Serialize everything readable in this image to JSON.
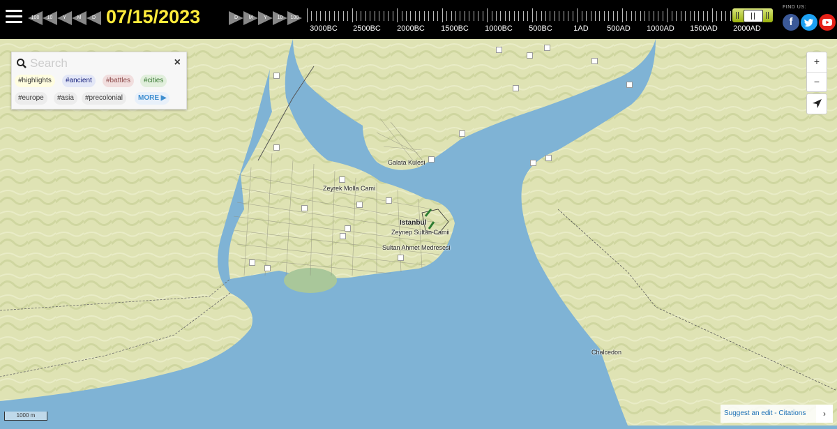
{
  "header": {
    "date": "07/15/2023",
    "back_buttons": [
      "100",
      "10",
      "Y",
      "M",
      "D"
    ],
    "forward_buttons": [
      "D",
      "M",
      "Y",
      "10",
      "100"
    ],
    "timeline_labels": [
      "3000BC",
      "2500BC",
      "2000BC",
      "1500BC",
      "1000BC",
      "500BC",
      "1AD",
      "500AD",
      "1000AD",
      "1500AD",
      "2000AD"
    ],
    "find_us": "FIND US:"
  },
  "social": {
    "facebook": "facebook-icon",
    "twitter": "twitter-icon",
    "youtube": "youtube-icon"
  },
  "search": {
    "placeholder": "Search",
    "close": "×",
    "tags": [
      "#highlights",
      "#ancient",
      "#battles",
      "#cities",
      "#europe",
      "#asia",
      "#precolonial"
    ],
    "more": "MORE ▶"
  },
  "controls": {
    "zoom_in": "+",
    "zoom_out": "−"
  },
  "map_labels": {
    "galata": "Galata Kulesi",
    "zeyrek": "Zeyrek Molla Cami",
    "istanbul": "Istanbul",
    "zeynep": "Zeynep Sultan Camii",
    "sultan_ahmet": "Sultan Ahmet Medresesi",
    "chalcedon": "Chalcedon"
  },
  "scale": "1000 m",
  "footer": {
    "suggest": "Suggest an edit",
    "sep": "-",
    "citations": "Citations",
    "arrow": "›"
  },
  "colors": {
    "date": "#ffeb3b",
    "land": "#dfe3b4",
    "water": "#7fb3d5",
    "hill_shade": "#c9d19a",
    "accent_link": "#1a6fb5"
  }
}
